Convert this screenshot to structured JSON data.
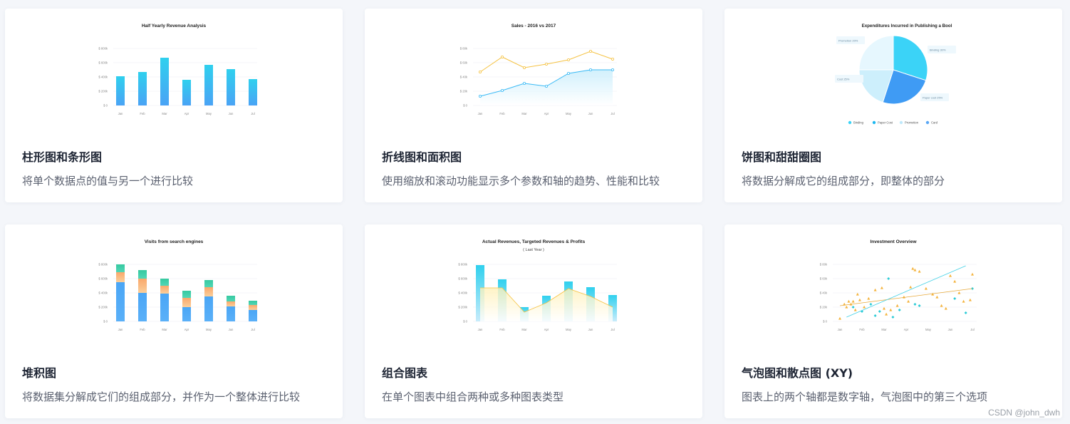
{
  "cards": [
    {
      "title": "柱形图和条形图",
      "desc": "将单个数据点的值与另一个进行比较"
    },
    {
      "title": "折线图和面积图",
      "desc": "使用缩放和滚动功能显示多个参数和轴的趋势、性能和比较"
    },
    {
      "title": "饼图和甜甜圈图",
      "desc": "将数据分解成它的组成部分，即整体的部分"
    },
    {
      "title": "堆积图",
      "desc": "将数据集分解成它们的组成部分，并作为一个整体进行比较"
    },
    {
      "title": "组合图表",
      "desc": "在单个图表中组合两种或多种图表类型"
    },
    {
      "title": "气泡图和散点图 (XY)",
      "desc": "图表上的两个轴都是数字轴，气泡图中的第三个选项"
    }
  ],
  "watermark": "CSDN @john_dwh",
  "colors": {
    "blue": "#38b9f5",
    "cyan": "#2fd0e6",
    "yellow": "#f5c242",
    "orange": "#f7a45a",
    "teal": "#36c9a4",
    "bg": "#f4f6fa"
  },
  "chart_data": [
    {
      "type": "bar",
      "title": "Half Yearly Revenue Analysis",
      "categories": [
        "Jan",
        "Feb",
        "Mar",
        "Apr",
        "May",
        "Jun",
        "Jul"
      ],
      "values": [
        410,
        470,
        670,
        360,
        570,
        510,
        370
      ],
      "yticks": [
        "$ 0",
        "$ 200k",
        "$ 400k",
        "$ 600k",
        "$ 800k"
      ],
      "ylim": [
        0,
        800
      ]
    },
    {
      "type": "line",
      "title": "Sales - 2016 vs 2017",
      "categories": [
        "Jan",
        "Feb",
        "Mar",
        "Apr",
        "May",
        "Jun",
        "Jul"
      ],
      "series": [
        {
          "values": [
            47,
            68,
            53,
            58,
            64,
            76,
            65
          ],
          "color": "#f5c242"
        },
        {
          "values": [
            13,
            21,
            31,
            27,
            45,
            50,
            50
          ],
          "color": "#38b9f5"
        }
      ],
      "yticks": [
        "$ 0",
        "$ 20k",
        "$ 40k",
        "$ 60k",
        "$ 80k"
      ],
      "ylim": [
        0,
        80
      ]
    },
    {
      "type": "pie",
      "title": "Expenditures Incurred in Publishing a Bool",
      "slices": [
        {
          "label": "Binding",
          "value": 30,
          "color": "#3bd3f7",
          "callout": "Binding 30%"
        },
        {
          "label": "Paper Cost",
          "value": 25,
          "color": "#3f9bf4",
          "callout": "Paper cost 25%"
        },
        {
          "label": "Promotion",
          "value": 20,
          "color": "#cdeffc",
          "callout": "Promotion 20%"
        },
        {
          "label": "Cost",
          "value": 25,
          "color": "#e6f7fe",
          "callout": "Cost 25%"
        }
      ],
      "legend": [
        "Binding",
        "Paper Cost",
        "Promotion",
        "Card"
      ],
      "legend_colors": [
        "#3bd3f7",
        "#1fb8f0",
        "#bfe9fb",
        "#5aa7f5"
      ]
    },
    {
      "type": "bar",
      "stacked": true,
      "title": "Visits from search engines",
      "categories": [
        "Jan",
        "Feb",
        "Mar",
        "Apr",
        "May",
        "Jun",
        "Jul"
      ],
      "series": [
        {
          "values": [
            550,
            400,
            390,
            200,
            350,
            210,
            160
          ],
          "color": "#4aa6f6"
        },
        {
          "values": [
            140,
            200,
            110,
            130,
            130,
            70,
            70
          ],
          "color": "#f9a86c"
        },
        {
          "values": [
            110,
            120,
            100,
            100,
            100,
            80,
            60
          ],
          "color": "#39c8a0"
        }
      ],
      "yticks": [
        "$ 0",
        "$ 200k",
        "$ 400k",
        "$ 600k",
        "$ 800k"
      ],
      "ylim": [
        0,
        800
      ]
    },
    {
      "type": "bar",
      "combo": true,
      "title": "Actual Revenues, Targeted Revenues & Profits",
      "subtitle": "( Last Year )",
      "categories": [
        "Jan",
        "Feb",
        "Mar",
        "Apr",
        "May",
        "Jun",
        "Jul"
      ],
      "bars": [
        790,
        590,
        200,
        360,
        560,
        480,
        370
      ],
      "area": [
        470,
        470,
        130,
        260,
        460,
        350,
        200
      ],
      "yticks": [
        "$ 0",
        "$ 200k",
        "$ 400k",
        "$ 600k",
        "$ 800k"
      ],
      "ylim": [
        0,
        800
      ]
    },
    {
      "type": "scatter",
      "title": "Investment Overview",
      "categories": [
        "Jan",
        "Feb",
        "Mar",
        "Apr",
        "May",
        "Jun",
        "Jul"
      ],
      "yticks": [
        "$ 0",
        "$ 20k",
        "$ 40k",
        "$ 60k",
        "$ 80k"
      ],
      "ylim": [
        0,
        80
      ],
      "series_a": [
        [
          0.0,
          4
        ],
        [
          0.2,
          24
        ],
        [
          0.3,
          20
        ],
        [
          0.4,
          28
        ],
        [
          0.5,
          24
        ],
        [
          0.6,
          28
        ],
        [
          0.7,
          16
        ],
        [
          0.9,
          30
        ],
        [
          0.8,
          38
        ],
        [
          1.1,
          20
        ],
        [
          1.3,
          32
        ],
        [
          1.6,
          44
        ],
        [
          1.9,
          47
        ],
        [
          2.0,
          18
        ],
        [
          2.3,
          16
        ],
        [
          2.1,
          10
        ],
        [
          2.6,
          22
        ],
        [
          2.9,
          34
        ],
        [
          3.1,
          28
        ],
        [
          3.2,
          48
        ],
        [
          3.3,
          74
        ],
        [
          3.6,
          70
        ],
        [
          3.4,
          72
        ],
        [
          3.9,
          46
        ],
        [
          4.2,
          38
        ],
        [
          4.4,
          34
        ],
        [
          4.6,
          22
        ],
        [
          4.8,
          18
        ],
        [
          5.0,
          64
        ],
        [
          5.2,
          56
        ],
        [
          5.4,
          40
        ],
        [
          5.6,
          28
        ],
        [
          5.9,
          30
        ],
        [
          6.0,
          66
        ]
      ],
      "series_b": [
        [
          0.6,
          20
        ],
        [
          1.0,
          14
        ],
        [
          1.4,
          24
        ],
        [
          1.6,
          8
        ],
        [
          1.8,
          14
        ],
        [
          2.2,
          60
        ],
        [
          2.4,
          6
        ],
        [
          2.7,
          16
        ],
        [
          3.4,
          24
        ],
        [
          3.6,
          22
        ],
        [
          5.2,
          32
        ],
        [
          5.7,
          12
        ],
        [
          6.0,
          46
        ]
      ],
      "trend_a": [
        [
          0,
          22
        ],
        [
          6,
          46
        ]
      ],
      "trend_b": [
        [
          0.3,
          6
        ],
        [
          5.7,
          78
        ]
      ]
    }
  ]
}
